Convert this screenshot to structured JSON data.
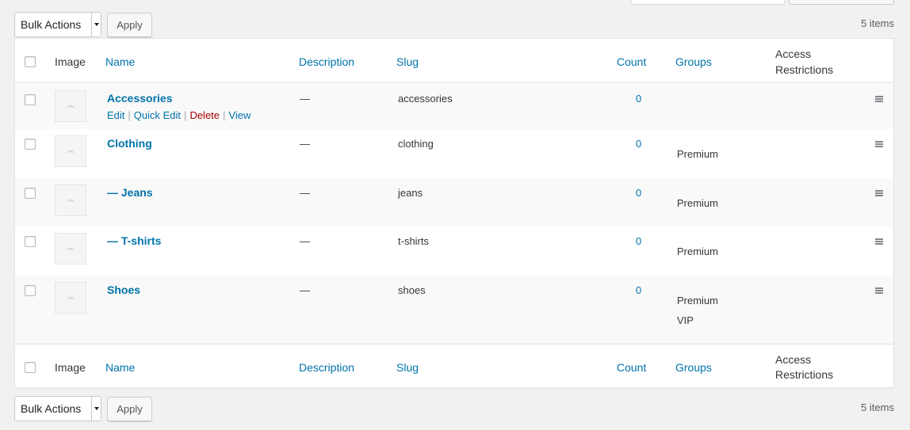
{
  "tablenav_top": {
    "bulk_actions": "Bulk Actions",
    "apply": "Apply",
    "items_count": "5 items"
  },
  "tablenav_bottom": {
    "bulk_actions": "Bulk Actions",
    "apply": "Apply",
    "items_count": "5 items"
  },
  "columns": {
    "image": "Image",
    "name": "Name",
    "description": "Description",
    "slug": "Slug",
    "count": "Count",
    "groups": "Groups",
    "access_line1": "Access",
    "access_line2": "Restrictions"
  },
  "row_actions": {
    "edit": "Edit",
    "quick_edit": "Quick Edit",
    "delete": "Delete",
    "view": "View"
  },
  "rows": [
    {
      "name": "Accessories",
      "description": "—",
      "slug": "accessories",
      "count": "0",
      "groups": []
    },
    {
      "name": "Clothing",
      "description": "—",
      "slug": "clothing",
      "count": "0",
      "groups": [
        "Premium"
      ]
    },
    {
      "name": "— Jeans",
      "description": "—",
      "slug": "jeans",
      "count": "0",
      "groups": [
        "Premium"
      ]
    },
    {
      "name": "— T-shirts",
      "description": "—",
      "slug": "t-shirts",
      "count": "0",
      "groups": [
        "Premium"
      ]
    },
    {
      "name": "Shoes",
      "description": "—",
      "slug": "shoes",
      "count": "0",
      "groups": [
        "Premium",
        "VIP"
      ]
    }
  ],
  "colors": {
    "link": "#0073aa",
    "delete": "#aa0000",
    "alt_row": "#f9f9f9"
  }
}
